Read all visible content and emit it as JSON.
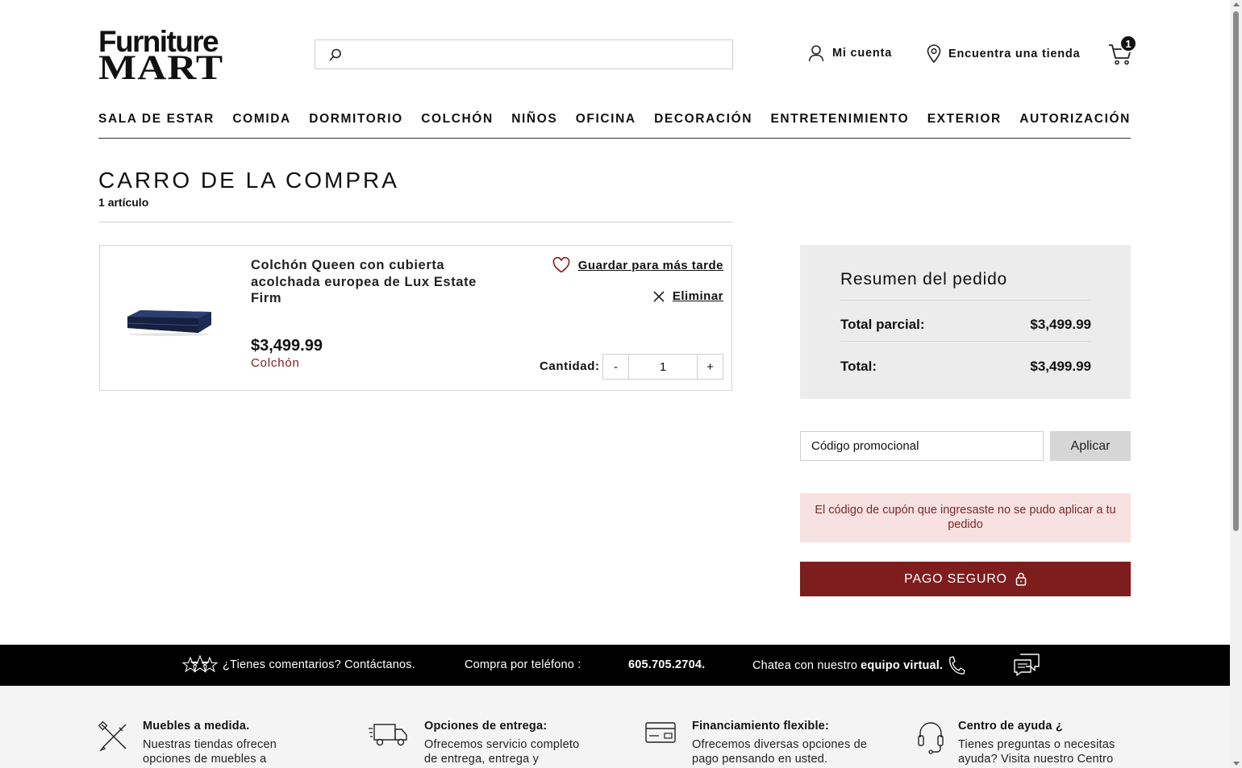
{
  "brand": {
    "line1": "Furniture",
    "line2": "MART"
  },
  "header": {
    "search_placeholder": "",
    "account_label": "Mi cuenta",
    "store_label": "Encuentra una tienda",
    "cart_count": "1"
  },
  "nav": [
    "SALA DE ESTAR",
    "COMIDA",
    "DORMITORIO",
    "COLCHÓN",
    "NIÑOS",
    "OFICINA",
    "DECORACIÓN",
    "ENTRETENIMIENTO",
    "EXTERIOR",
    "AUTORIZACIÓN"
  ],
  "cart": {
    "title": "CARRO DE LA COMPRA",
    "count_number": "1",
    "count_word": "artículo",
    "item": {
      "name": "Colchón Queen con cubierta acolchada europea de Lux Estate Firm",
      "price": "$3,499.99",
      "category": "Colchón",
      "save_label": "Guardar para más tarde",
      "remove_label": "Eliminar",
      "qty_label": "Cantidad:",
      "qty_minus": "-",
      "qty_value": "1",
      "qty_plus": "+"
    }
  },
  "summary": {
    "title": "Resumen del pedido",
    "subtotal_label": "Total parcial:",
    "subtotal_value": "$3,499.99",
    "total_label": "Total:",
    "total_value": "$3,499.99"
  },
  "promo": {
    "placeholder": "Código promocional",
    "apply_label": "Aplicar",
    "error": "El código de cupón que ingresaste no se pudo aplicar a tu pedido"
  },
  "checkout_label": "PAGO SEGURO",
  "band": {
    "feedback": "¿Tienes comentarios? Contáctanos.",
    "phone_label": "Compra por teléfono :",
    "phone_number": "605.705.2704.",
    "chat_prefix": "Chatea con nuestro",
    "chat_bold": "equipo virtual."
  },
  "features": [
    {
      "title": "Muebles a medida.",
      "desc": "Nuestras tiendas ofrecen opciones de muebles a",
      "icon": "tools-icon"
    },
    {
      "title": "Opciones de entrega:",
      "desc": "Ofrecemos servicio completo de entrega, entrega y",
      "icon": "truck-icon"
    },
    {
      "title": "Financiamiento flexible:",
      "desc": "Ofrecemos diversas opciones de pago pensando en usted.",
      "icon": "credit-card-icon"
    },
    {
      "title": "Centro de ayuda ¿",
      "desc": "Tienes preguntas o necesitas ayuda? Visita nuestro Centro",
      "icon": "headset-icon"
    }
  ],
  "colors": {
    "brand_red": "#7d1d1d",
    "alert_bg": "#f8e1e1",
    "summary_bg": "#ececec"
  }
}
